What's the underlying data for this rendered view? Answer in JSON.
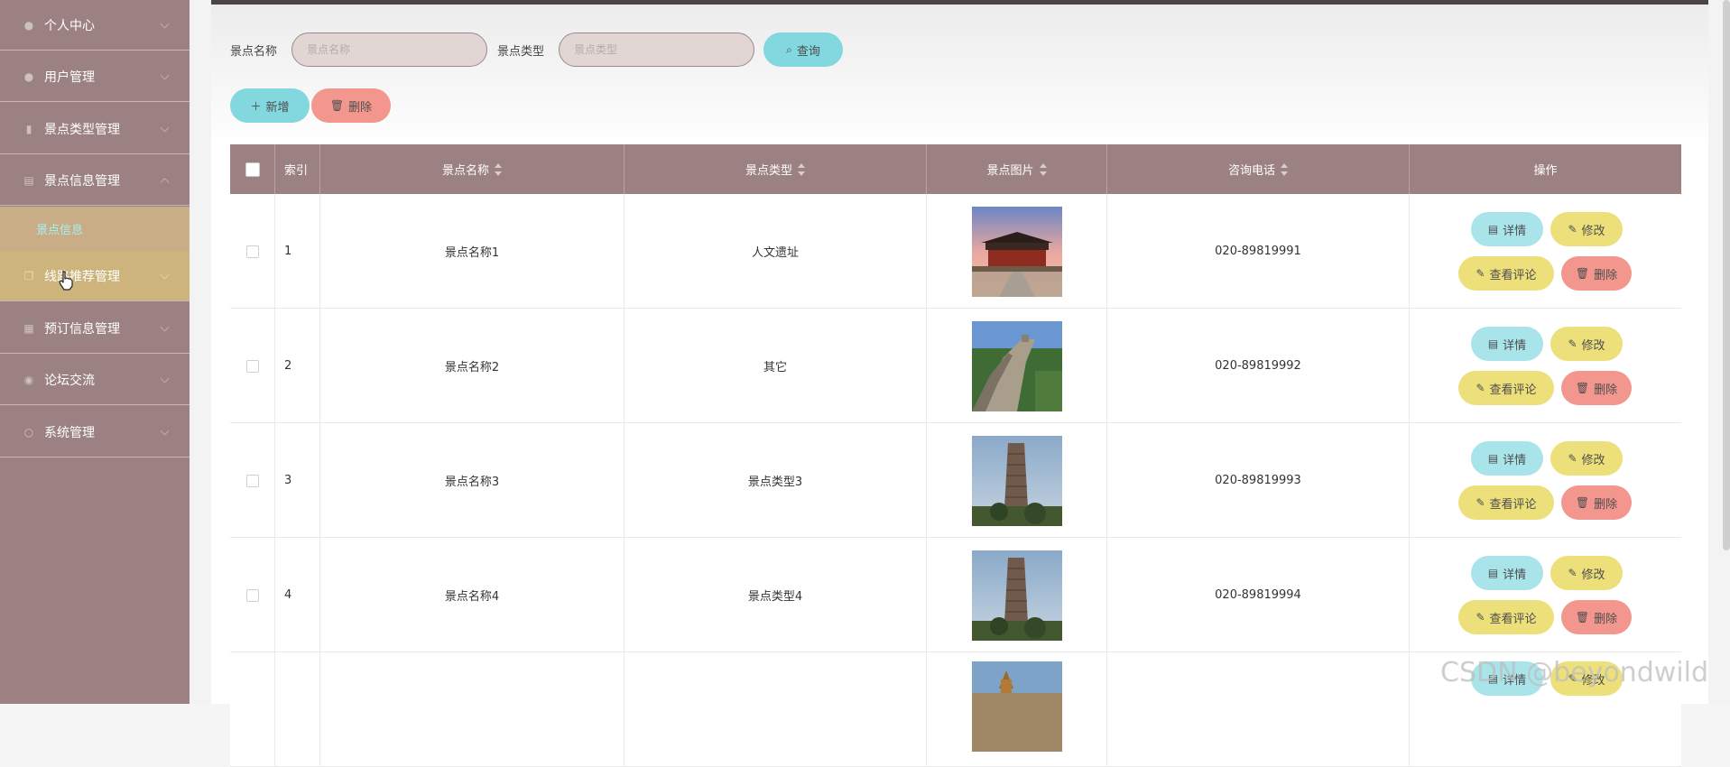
{
  "sidebar": {
    "items": [
      {
        "label": "个人中心",
        "icon": "user-icon"
      },
      {
        "label": "用户管理",
        "icon": "users-icon"
      },
      {
        "label": "景点类型管理",
        "icon": "chart-icon"
      },
      {
        "label": "景点信息管理",
        "icon": "list-icon"
      },
      {
        "label": "线路推荐管理",
        "icon": "copy-icon"
      },
      {
        "label": "预订信息管理",
        "icon": "calendar-icon"
      },
      {
        "label": "论坛交流",
        "icon": "chat-icon"
      },
      {
        "label": "系统管理",
        "icon": "settings-icon"
      }
    ],
    "submenu": {
      "label": "景点信息"
    }
  },
  "search": {
    "name_label": "景点名称",
    "name_placeholder": "景点名称",
    "type_label": "景点类型",
    "type_placeholder": "景点类型",
    "query_button": "查询"
  },
  "toolbar": {
    "add_label": "新增",
    "delete_label": "删除"
  },
  "table": {
    "headers": {
      "index": "索引",
      "name": "景点名称",
      "type": "景点类型",
      "image": "景点图片",
      "phone": "咨询电话",
      "action": "操作"
    },
    "actions": {
      "detail": "详情",
      "edit": "修改",
      "comments": "查看评论",
      "delete": "删除"
    },
    "rows": [
      {
        "index": "1",
        "name": "景点名称1",
        "type": "人文遗址",
        "image": "palace-photo",
        "phone": "020-89819991"
      },
      {
        "index": "2",
        "name": "景点名称2",
        "type": "其它",
        "image": "great-wall-photo",
        "phone": "020-89819992"
      },
      {
        "index": "3",
        "name": "景点名称3",
        "type": "景点类型3",
        "image": "pagoda-photo",
        "phone": "020-89819993"
      },
      {
        "index": "4",
        "name": "景点名称4",
        "type": "景点类型4",
        "image": "pagoda-photo",
        "phone": "020-89819994"
      },
      {
        "index": "",
        "name": "",
        "type": "",
        "image": "mountain-temple-photo",
        "phone": ""
      }
    ]
  },
  "watermark": "CSDN @beyondwild",
  "colors": {
    "sidebar": "#9c8182",
    "accent_cyan": "#82d8de",
    "accent_yellow": "#ede07b",
    "accent_red": "#f2968e"
  }
}
